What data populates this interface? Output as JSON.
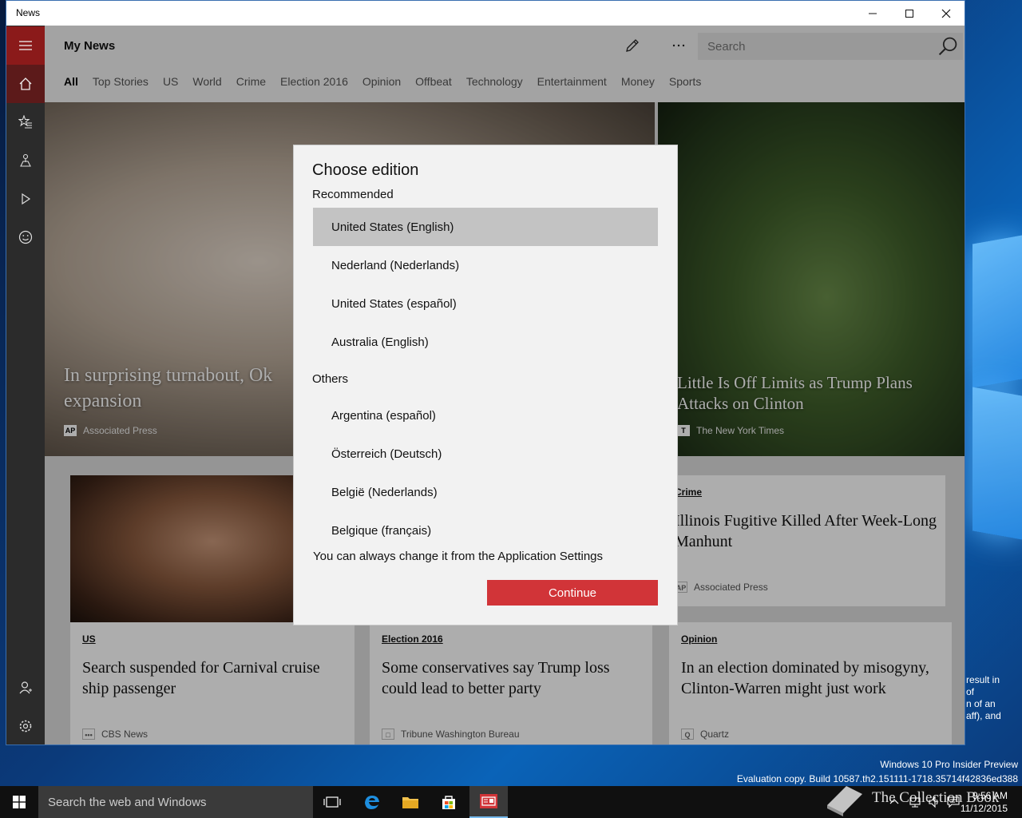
{
  "window": {
    "title": "News"
  },
  "header": {
    "title": "My News",
    "search_placeholder": "Search"
  },
  "tabs": [
    {
      "label": "All",
      "active": true
    },
    {
      "label": "Top Stories"
    },
    {
      "label": "US"
    },
    {
      "label": "World"
    },
    {
      "label": "Crime"
    },
    {
      "label": "Election 2016"
    },
    {
      "label": "Opinion"
    },
    {
      "label": "Offbeat"
    },
    {
      "label": "Technology"
    },
    {
      "label": "Entertainment"
    },
    {
      "label": "Money"
    },
    {
      "label": "Sports"
    }
  ],
  "heroes": [
    {
      "headline": "In surprising turnabout, Ok",
      "headline_line2": "expansion",
      "source": "Associated Press",
      "source_logo": "AP"
    },
    {
      "headline": "Little Is Off Limits as Trump Plans Attacks on Clinton",
      "source": "The New York Times",
      "source_logo": "T"
    }
  ],
  "cards": [
    {
      "kicker": "Crime",
      "headline": "Illinois Fugitive Killed After Week-Long Manhunt",
      "source": "Associated Press",
      "source_logo": "AP"
    },
    {
      "kicker": "US",
      "headline": "Search suspended for Carnival cruise ship passenger",
      "source": "CBS News",
      "source_logo": "•••"
    },
    {
      "kicker": "Election 2016",
      "headline": "Some conservatives say Trump loss could lead to better party",
      "source": "Tribune Washington Bureau",
      "source_logo": "□"
    },
    {
      "kicker": "Opinion",
      "headline": "In an election dominated by misogyny, Clinton-Warren might just work",
      "source": "Quartz",
      "source_logo": "Q"
    }
  ],
  "dialog": {
    "title": "Choose edition",
    "recommended_label": "Recommended",
    "recommended": [
      {
        "label": "United States (English)",
        "selected": true
      },
      {
        "label": "Nederland (Nederlands)"
      },
      {
        "label": "United States (español)"
      },
      {
        "label": "Australia (English)"
      }
    ],
    "others_label": "Others",
    "others": [
      {
        "label": "Argentina (español)"
      },
      {
        "label": "Österreich (Deutsch)"
      },
      {
        "label": "België (Nederlands)"
      },
      {
        "label": "Belgique (français)"
      }
    ],
    "note": "You can always change it from the Application Settings",
    "continue_label": "Continue"
  },
  "desktop": {
    "side_text": [
      "result in",
      "of",
      "n of an",
      "aff), and"
    ],
    "watermark_line1": "Windows 10 Pro Insider Preview",
    "watermark_line2": "Evaluation copy. Build 10587.th2.151111-1718.35714f42836ed388"
  },
  "taskbar": {
    "search_text": "Search the web and Windows",
    "time": "9:56 AM",
    "date": "11/12/2015",
    "brand_text": "The Collection Book"
  },
  "colors": {
    "accent": "#d13438",
    "sidebar": "#2b2b2b",
    "hamburger": "#8b1a1a"
  },
  "icons": {
    "sidebar": [
      "hamburger-icon",
      "home-icon",
      "interests-icon",
      "local-icon",
      "video-icon",
      "emoji-icon",
      "account-icon",
      "settings-icon"
    ],
    "header": [
      "edit-icon",
      "more-icon",
      "search-icon"
    ]
  }
}
